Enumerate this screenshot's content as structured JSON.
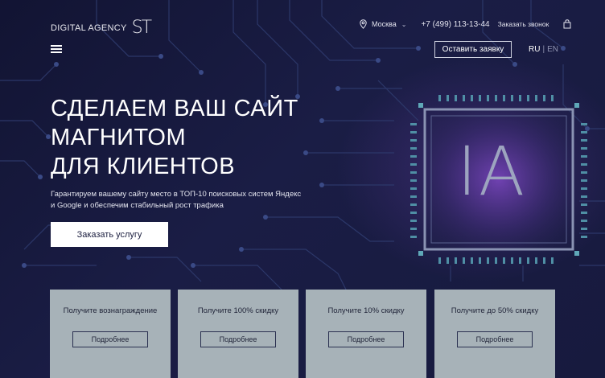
{
  "header": {
    "logo_text": "DIGITAL AGENCY",
    "logo_mark": "ST",
    "city": "Москва",
    "phone": "+7 (499) 113-13-44",
    "callback": "Заказать звонок",
    "cta": "Оставить заявку",
    "lang_active": "RU",
    "lang_separator": "|",
    "lang_other": "EN"
  },
  "hero": {
    "title_lines": [
      "СДЕЛАЕМ ВАШ САЙТ",
      "МАГНИТОМ",
      "ДЛЯ КЛИЕНТОВ"
    ],
    "subtitle_lines": [
      "Гарантируем вашему сайту место в ТОП-10 поисковых систем Яндекс",
      "и Google и обеспечим стабильный рост трафика"
    ],
    "order_button": "Заказать услугу",
    "chip_text": "IA"
  },
  "cards": [
    {
      "title": "Получите вознаграждение",
      "button": "Подробнее"
    },
    {
      "title": "Получите 100% скидку",
      "button": "Подробнее"
    },
    {
      "title": "Получите 10% скидку",
      "button": "Подробнее"
    },
    {
      "title": "Получите до 50% скидку",
      "button": "Подробнее"
    }
  ],
  "icons": [
    "location-pin-icon",
    "chevron-down-icon",
    "shopping-bag-icon",
    "menu-icon"
  ],
  "colors": {
    "background": "#17193a",
    "card": "#a7b2b8",
    "button": "#ffffff",
    "chip_glow": "#7a46be"
  }
}
